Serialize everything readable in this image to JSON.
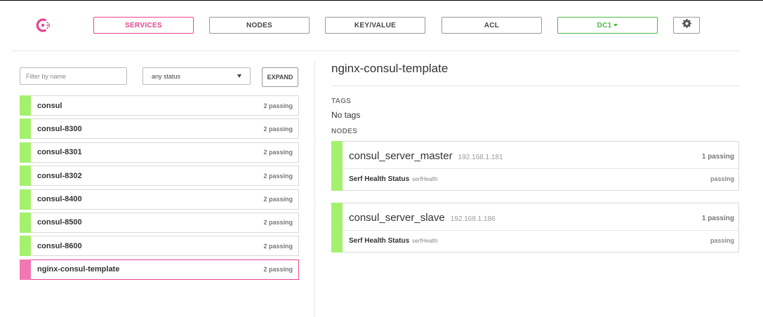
{
  "nav": {
    "services": "SERVICES",
    "nodes": "NODES",
    "keyvalue": "KEY/VALUE",
    "acl": "ACL",
    "datacenter": "DC1"
  },
  "colors": {
    "accent": "#e7448f",
    "passing": "#a5f16d",
    "selected_bar": "#f377b3",
    "datacenter": "#4cb944"
  },
  "icons": {
    "logo": "consul-logo-icon",
    "settings": "gear-icon",
    "dropdown": "caret-down-icon"
  },
  "filters": {
    "name_placeholder": "Filter by name",
    "status_value": "any status",
    "expand_label": "EXPAND"
  },
  "services": [
    {
      "name": "consul",
      "status": "2 passing"
    },
    {
      "name": "consul-8300",
      "status": "2 passing"
    },
    {
      "name": "consul-8301",
      "status": "2 passing"
    },
    {
      "name": "consul-8302",
      "status": "2 passing"
    },
    {
      "name": "consul-8400",
      "status": "2 passing"
    },
    {
      "name": "consul-8500",
      "status": "2 passing"
    },
    {
      "name": "consul-8600",
      "status": "2 passing"
    },
    {
      "name": "nginx-consul-template",
      "status": "2 passing",
      "selected": true
    }
  ],
  "detail": {
    "title": "nginx-consul-template",
    "tags_label": "TAGS",
    "tags_value": "No tags",
    "nodes_label": "NODES",
    "nodes": [
      {
        "name": "consul_server_master",
        "ip": "192.168.1.181",
        "status": "1 passing",
        "check": {
          "name": "Serf Health Status",
          "id": "serfHealth",
          "status": "passing"
        }
      },
      {
        "name": "consul_server_slave",
        "ip": "192.168.1.186",
        "status": "1 passing",
        "check": {
          "name": "Serf Health Status",
          "id": "serfHealth",
          "status": "passing"
        }
      }
    ]
  }
}
